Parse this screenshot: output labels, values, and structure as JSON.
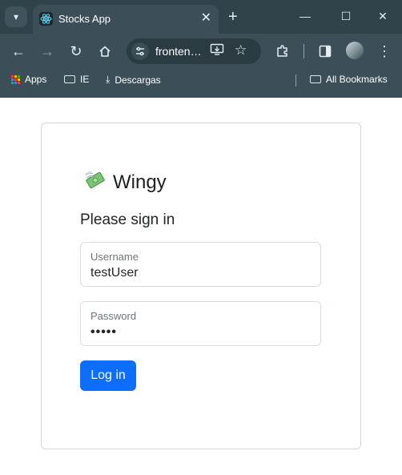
{
  "browser": {
    "tab_title": "Stocks App",
    "url_display": "fronten…",
    "bookmarks": [
      "Apps",
      "IE",
      "Descargas",
      "All Bookmarks"
    ],
    "icons": {
      "tab_search": "chevron-down-icon",
      "favicon": "react-icon",
      "back": "back-arrow-icon",
      "forward": "forward-arrow-icon",
      "reload": "reload-icon",
      "home": "home-icon",
      "extensions": "puzzle-icon",
      "sidepanel": "side-panel-icon",
      "menu": "kebab-menu-icon"
    },
    "colors": {
      "frame": "#30424a",
      "toolbar": "#3c4f58"
    }
  },
  "app": {
    "brand_name": "Wingy",
    "brand_icon": "money-with-wings-icon",
    "heading": "Please sign in",
    "username": {
      "label": "Username",
      "value": "testUser"
    },
    "password": {
      "label": "Password",
      "value": "•••••"
    },
    "submit_label": "Log in",
    "colors": {
      "primary": "#0d6efd",
      "border": "#d8dce0"
    }
  }
}
